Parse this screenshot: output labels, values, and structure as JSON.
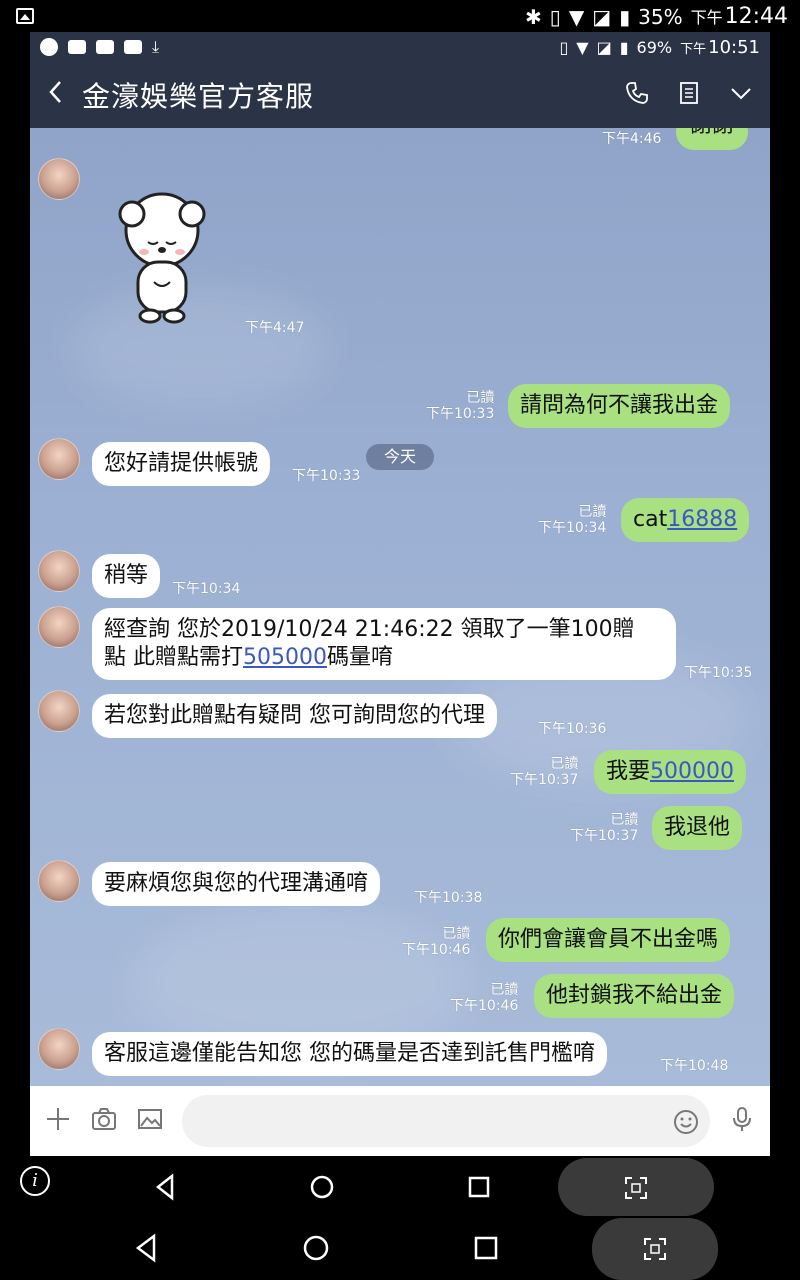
{
  "outer_status": {
    "battery": "35%",
    "time_prefix": "下午",
    "time": "12:44"
  },
  "inner_status": {
    "battery": "69%",
    "time_prefix": "下午",
    "time": "10:51"
  },
  "header": {
    "title": "金濠娛樂官方客服"
  },
  "top_partial": {
    "text": "謝謝",
    "time": "下午4:46"
  },
  "sticker_time": "下午4:47",
  "day_label": "今天",
  "messages": [
    {
      "dir": "out",
      "text": "請問為何不讓我出金",
      "read": "已讀",
      "time": "下午10:33"
    },
    {
      "dir": "in",
      "text": "您好請提供帳號",
      "time": "下午10:33"
    },
    {
      "dir": "out",
      "text_plain": "cat",
      "text_link": "16888",
      "read": "已讀",
      "time": "下午10:34"
    },
    {
      "dir": "in",
      "text": "稍等",
      "time": "下午10:34"
    },
    {
      "dir": "in",
      "line1": "經查詢 您於2019/10/24 21:46:22 領取了一筆100贈",
      "line2_pre": "點 此贈點需打",
      "line2_link": "505000",
      "line2_post": "碼量唷",
      "time": "下午10:35"
    },
    {
      "dir": "in",
      "text": "若您對此贈點有疑問 您可詢問您的代理",
      "time": "下午10:36"
    },
    {
      "dir": "out",
      "text_plain": "我要",
      "text_link": "500000",
      "read": "已讀",
      "time": "下午10:37"
    },
    {
      "dir": "out",
      "text": "我退他",
      "read": "已讀",
      "time": "下午10:37"
    },
    {
      "dir": "in",
      "text": "要麻煩您與您的代理溝通唷",
      "time": "下午10:38"
    },
    {
      "dir": "out",
      "text": "你們會讓會員不出金嗎",
      "read": "已讀",
      "time": "下午10:46"
    },
    {
      "dir": "out",
      "text": "他封鎖我不給出金",
      "read": "已讀",
      "time": "下午10:46"
    },
    {
      "dir": "in",
      "text": "客服這邊僅能告知您 您的碼量是否達到託售門檻唷",
      "time": "下午10:48"
    }
  ]
}
